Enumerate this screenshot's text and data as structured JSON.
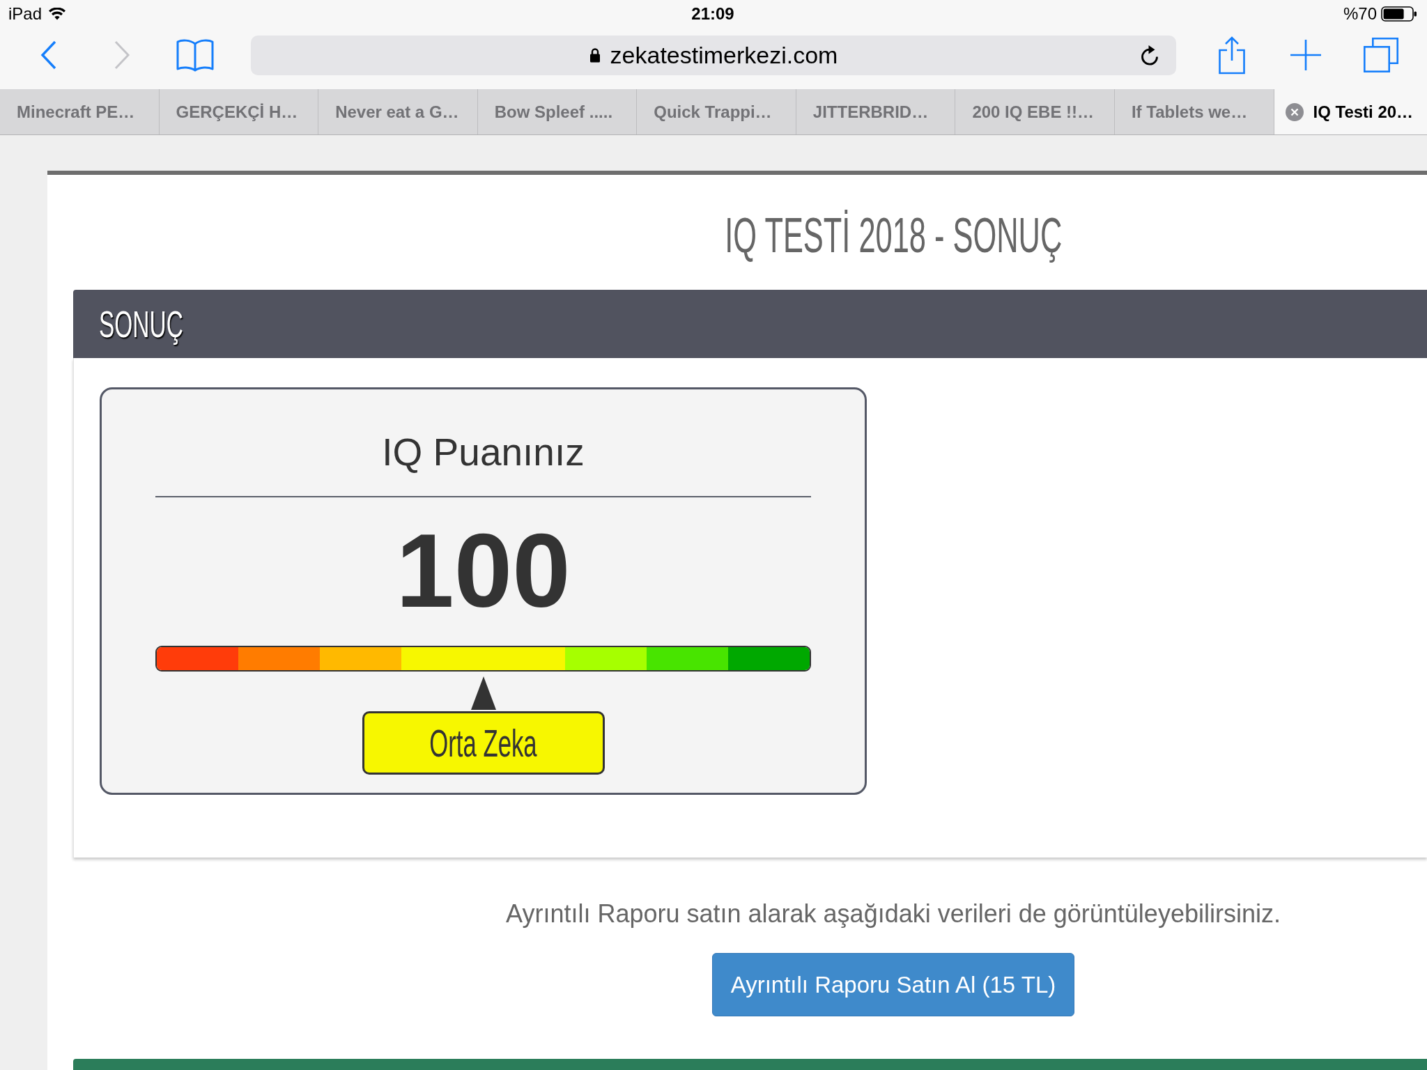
{
  "status_bar": {
    "device": "iPad",
    "time": "21:09",
    "battery": "%70"
  },
  "toolbar": {
    "back_disabled": false,
    "forward_disabled": true,
    "secure": true,
    "url": "zekatestimerkezi.com"
  },
  "tabs": [
    {
      "title": "Minecraft PE…",
      "selected": false
    },
    {
      "title": "GERÇEKÇİ H…",
      "selected": false
    },
    {
      "title": "Never eat a G…",
      "selected": false
    },
    {
      "title": "Bow Spleef .....",
      "selected": false
    },
    {
      "title": "Quick Trappi…",
      "selected": false
    },
    {
      "title": "JITTERBRID…",
      "selected": false
    },
    {
      "title": "200 IQ EBE !!…",
      "selected": false
    },
    {
      "title": "If Tablets we…",
      "selected": false
    },
    {
      "title": "IQ Testi 20…",
      "selected": true
    }
  ],
  "page": {
    "title": "IQ TESTİ 2018 - SONUÇ",
    "panel": {
      "heading": "SONUÇ",
      "score_card": {
        "label": "IQ Puanınız",
        "score": "100",
        "scale": {
          "segments": [
            {
              "color": "#ff3c0a"
            },
            {
              "color": "#ff7c00"
            },
            {
              "color": "#ffb900"
            },
            {
              "color": "#f7f700"
            },
            {
              "color": "#f7f700"
            },
            {
              "color": "#a6ff00"
            },
            {
              "color": "#48e400"
            },
            {
              "color": "#00a800"
            }
          ],
          "level": 0.5
        },
        "result": "Orta Zeka"
      }
    },
    "note": "Ayrıntılı Raporu satın alarak aşağıdaki verileri de görüntüleyebilirsiniz.",
    "buy_button": "Ayrıntılı Raporu Satın Al (15 TL)"
  }
}
